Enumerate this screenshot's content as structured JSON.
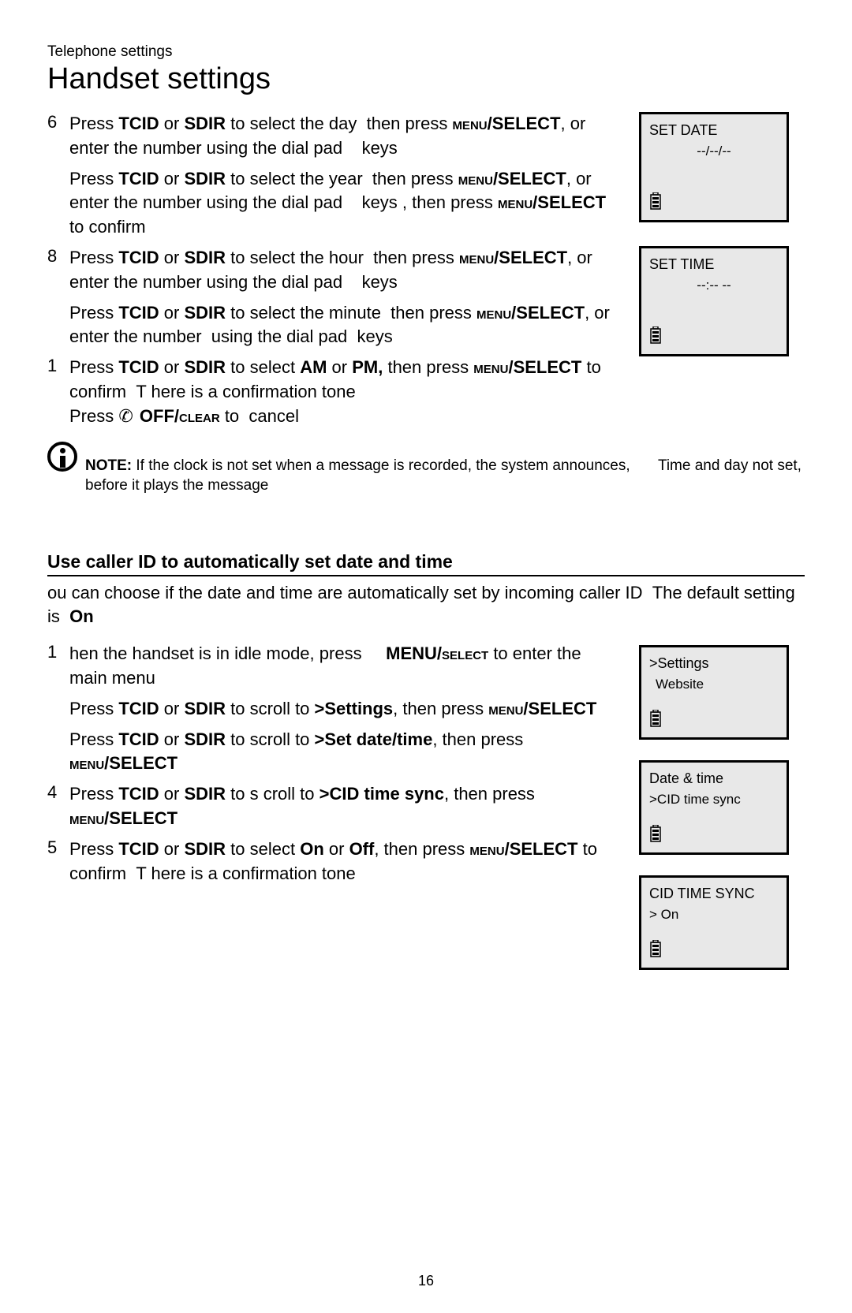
{
  "header": {
    "small": "Telephone settings",
    "large": "Handset settings"
  },
  "section1": {
    "steps": [
      {
        "num": "6",
        "body_html": "Press <b>TCID</b> or <b>SDIR</b> to select the day&nbsp;&nbsp;then press <b><span style='font-variant:small-caps'>menu</span>/SELECT</b>, or enter the number using the dial pad&nbsp;&nbsp;&nbsp;&nbsp;keys"
      },
      {
        "num": "",
        "body_html": "Press <b>TCID</b> or <b>SDIR</b> to select the year&nbsp;&nbsp;then press <b><span style='font-variant:small-caps'>menu</span>/SELECT</b>, or enter the number using the dial pad&nbsp;&nbsp;&nbsp;&nbsp;keys , then press <b><span style='font-variant:small-caps'>menu</span>/SELECT</b> to confirm",
        "indent_only": true
      },
      {
        "num": "8",
        "body_html": "Press <b>TCID</b> or <b>SDIR</b> to select the hour&nbsp;&nbsp;then press <b><span style='font-variant:small-caps'>menu</span>/SELECT</b>, or enter the number using the dial pad&nbsp;&nbsp;&nbsp;&nbsp;keys"
      },
      {
        "num": "",
        "body_html": "Press <b>TCID</b> or <b>SDIR</b> to select the minute&nbsp;&nbsp;then press <b><span style='font-variant:small-caps'>menu</span>/SELECT</b>, or enter the number&nbsp;&nbsp;using the dial pad&nbsp;&nbsp;keys",
        "indent_only": true
      },
      {
        "num": "1",
        "body_html": "Press <b>TCID</b> or <b>SDIR</b> to select <b>AM</b> or <b>PM,</b> then press <b><span style='font-variant:small-caps'>menu</span>/SELECT</b> to confirm&nbsp;&nbsp;T here is a confirmation tone<br>Press <span class='phone-glyph'>✆</span> <b>OFF/<span style='font-variant:small-caps'>clear</span></b> to&nbsp;&nbsp;cancel"
      }
    ],
    "lcds": [
      {
        "line1": "SET DATE",
        "line2": "--/--/--"
      },
      {
        "line1": "SET TIME",
        "line2": "--:-- --"
      }
    ],
    "note": {
      "label": "NOTE:",
      "rest": " If the clock is not set when a message is recorded, the system announces, ",
      "emph": "Time and day not set,",
      "tail": " before it plays the message"
    }
  },
  "section2": {
    "heading": "Use caller ID to automatically set date and time",
    "intro_html": "ou can choose if the date and time are automatically set by incoming caller ID&nbsp;&nbsp;The default setting is&nbsp;&nbsp;<b>On</b>",
    "steps": [
      {
        "num": "1",
        "body_html": "hen the handset is in idle mode, press&nbsp;&nbsp;&nbsp;&nbsp;&nbsp;<b>MENU/<span style='font-variant:small-caps'>select</span></b> to enter the main menu"
      },
      {
        "num": "",
        "body_html": "Press <b>TCID</b> or <b>SDIR</b> to scroll to <b>&gt;Settings</b>, then press <b><span style='font-variant:small-caps'>menu</span>/SELECT</b>",
        "indent_only": true
      },
      {
        "num": "",
        "body_html": "Press <b>TCID</b> or <b>SDIR</b> to scroll to <b>&gt;Set date/time</b>, then press <b><span style='font-variant:small-caps'>menu</span>/SELECT</b>",
        "indent_only": true
      },
      {
        "num": "4",
        "body_html": "Press <b>TCID</b> or <b>SDIR</b> to s croll to <b>&gt;CID time sync</b>, then press <b><span style='font-variant:small-caps'>menu</span>/SELECT</b>"
      },
      {
        "num": "5",
        "body_html": "Press <b>TCID</b> or <b>SDIR</b> to select <b>On</b> or <b>Off</b>, then press <b><span style='font-variant:small-caps'>menu</span>/SELECT</b> to confirm&nbsp;&nbsp;T here is a confirmation tone"
      }
    ],
    "lcds": [
      {
        "line1": ">Settings",
        "line2": "Website",
        "align": "left",
        "line2_indent": true
      },
      {
        "line1": " Date & time",
        "line2": ">CID time sync",
        "align": "left"
      },
      {
        "line1": " CID TIME SYNC",
        "line2": "> On",
        "align": "left"
      }
    ]
  },
  "page_number": "16",
  "battery_glyph": "🄱"
}
